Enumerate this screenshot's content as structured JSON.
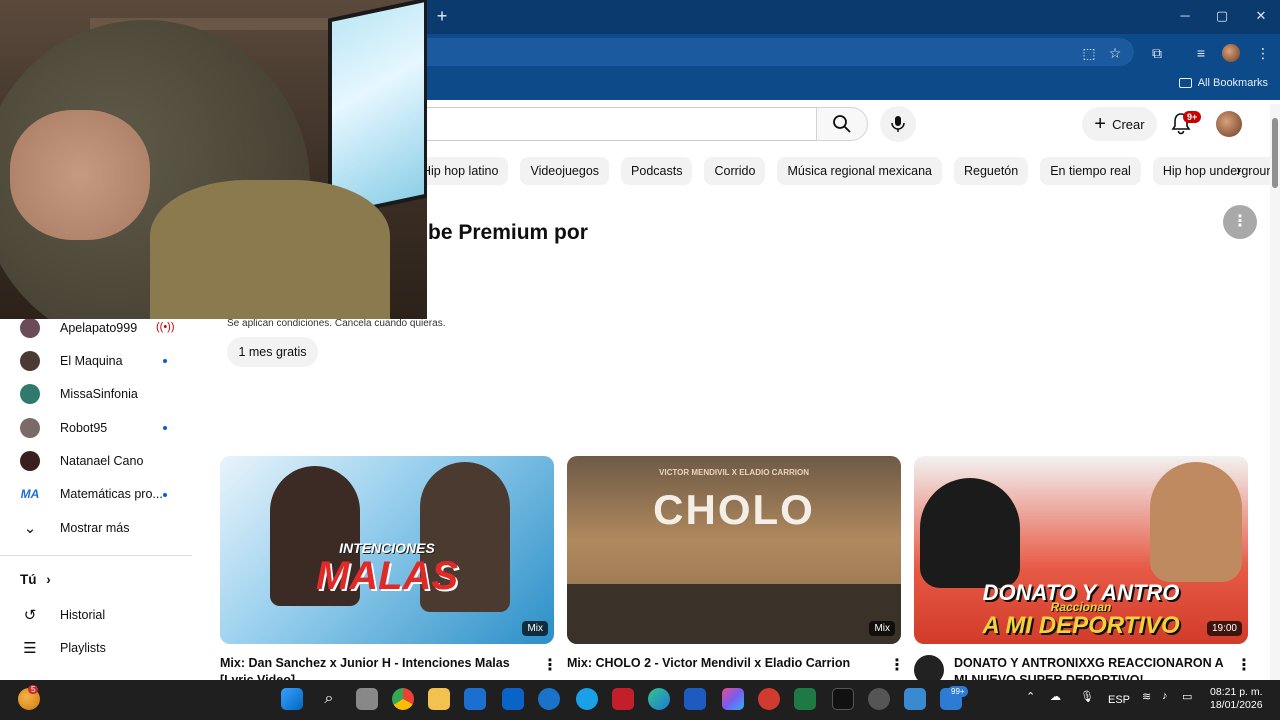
{
  "browser": {
    "new_tab": "+",
    "bookmarks_all": "All Bookmarks",
    "window_min": "─",
    "window_max": "▢",
    "window_close": "✕"
  },
  "youtube": {
    "create_label": "Crear",
    "notifications_badge": "9+"
  },
  "chips": [
    "Hip hop latino",
    "Videojuegos",
    "Podcasts",
    "Corrido",
    "Música regional mexicana",
    "Reguetón",
    "En tiempo real",
    "Hip hop underground"
  ],
  "promo": {
    "title_visible": "be Premium por",
    "terms": "Se aplican condiciones. Cancela cuando quieras.",
    "button": "1 mes gratis"
  },
  "sidebar": {
    "subscriptions": [
      {
        "name": "Apelapato999",
        "status": "live",
        "avatar_color": "#6b4a5a"
      },
      {
        "name": "El Maquina",
        "status": "new",
        "avatar_color": "#4a3a33"
      },
      {
        "name": "MissaSinfonia",
        "status": "none",
        "avatar_color": "#2f7a6d"
      },
      {
        "name": "Robot95",
        "status": "new",
        "avatar_color": "#7a6a6a"
      },
      {
        "name": "Natanael Cano",
        "status": "none",
        "avatar_color": "#3a1f1f"
      },
      {
        "name": "Matemáticas pro...",
        "status": "new",
        "avatar_color": "#1f6fd1"
      }
    ],
    "live_glyph": "((•))",
    "show_more": "Mostrar más",
    "you_section": "Tú",
    "you_chevron": "›",
    "history": "Historial",
    "playlists": "Playlists"
  },
  "videos": [
    {
      "title": "Mix: Dan Sanchez x Junior H - Intenciones Malas",
      "title_line2": "[Lyric Video]",
      "badge": "Mix",
      "thumb_text": "MALAS",
      "thumb_subtext": "INTENCIONES",
      "thumb_bg": "#2b8fc7"
    },
    {
      "title": "Mix: CHOLO 2 - Victor Mendivil x Eladio Carrion",
      "badge": "Mix",
      "thumb_text": "CHOLO",
      "thumb_subtext": "VICTOR MENDIVIL X ELADIO CARRION",
      "thumb_bg": "#8a6a4a"
    },
    {
      "title": "DONATO Y ANTRONIXXG REACCIONARON A",
      "title_line2": "MI NUEVO SUPER DEPORTIVO!",
      "badge": "19:00",
      "thumb_text": "A MI DEPORTIVO",
      "thumb_subtext": "DONATO Y ANTRO",
      "thumb_subtext2": "Raccionan",
      "thumb_bg": "#d23b2a"
    }
  ],
  "taskbar": {
    "notification_count": "5",
    "app_badge": "99+",
    "language": "ESP",
    "time": "08:21 p. m.",
    "date": "18/01/2026"
  },
  "colors": {
    "browser_frame": "#0b3a6e",
    "link_blue": "#065fd4",
    "live_red": "#cc0000"
  }
}
